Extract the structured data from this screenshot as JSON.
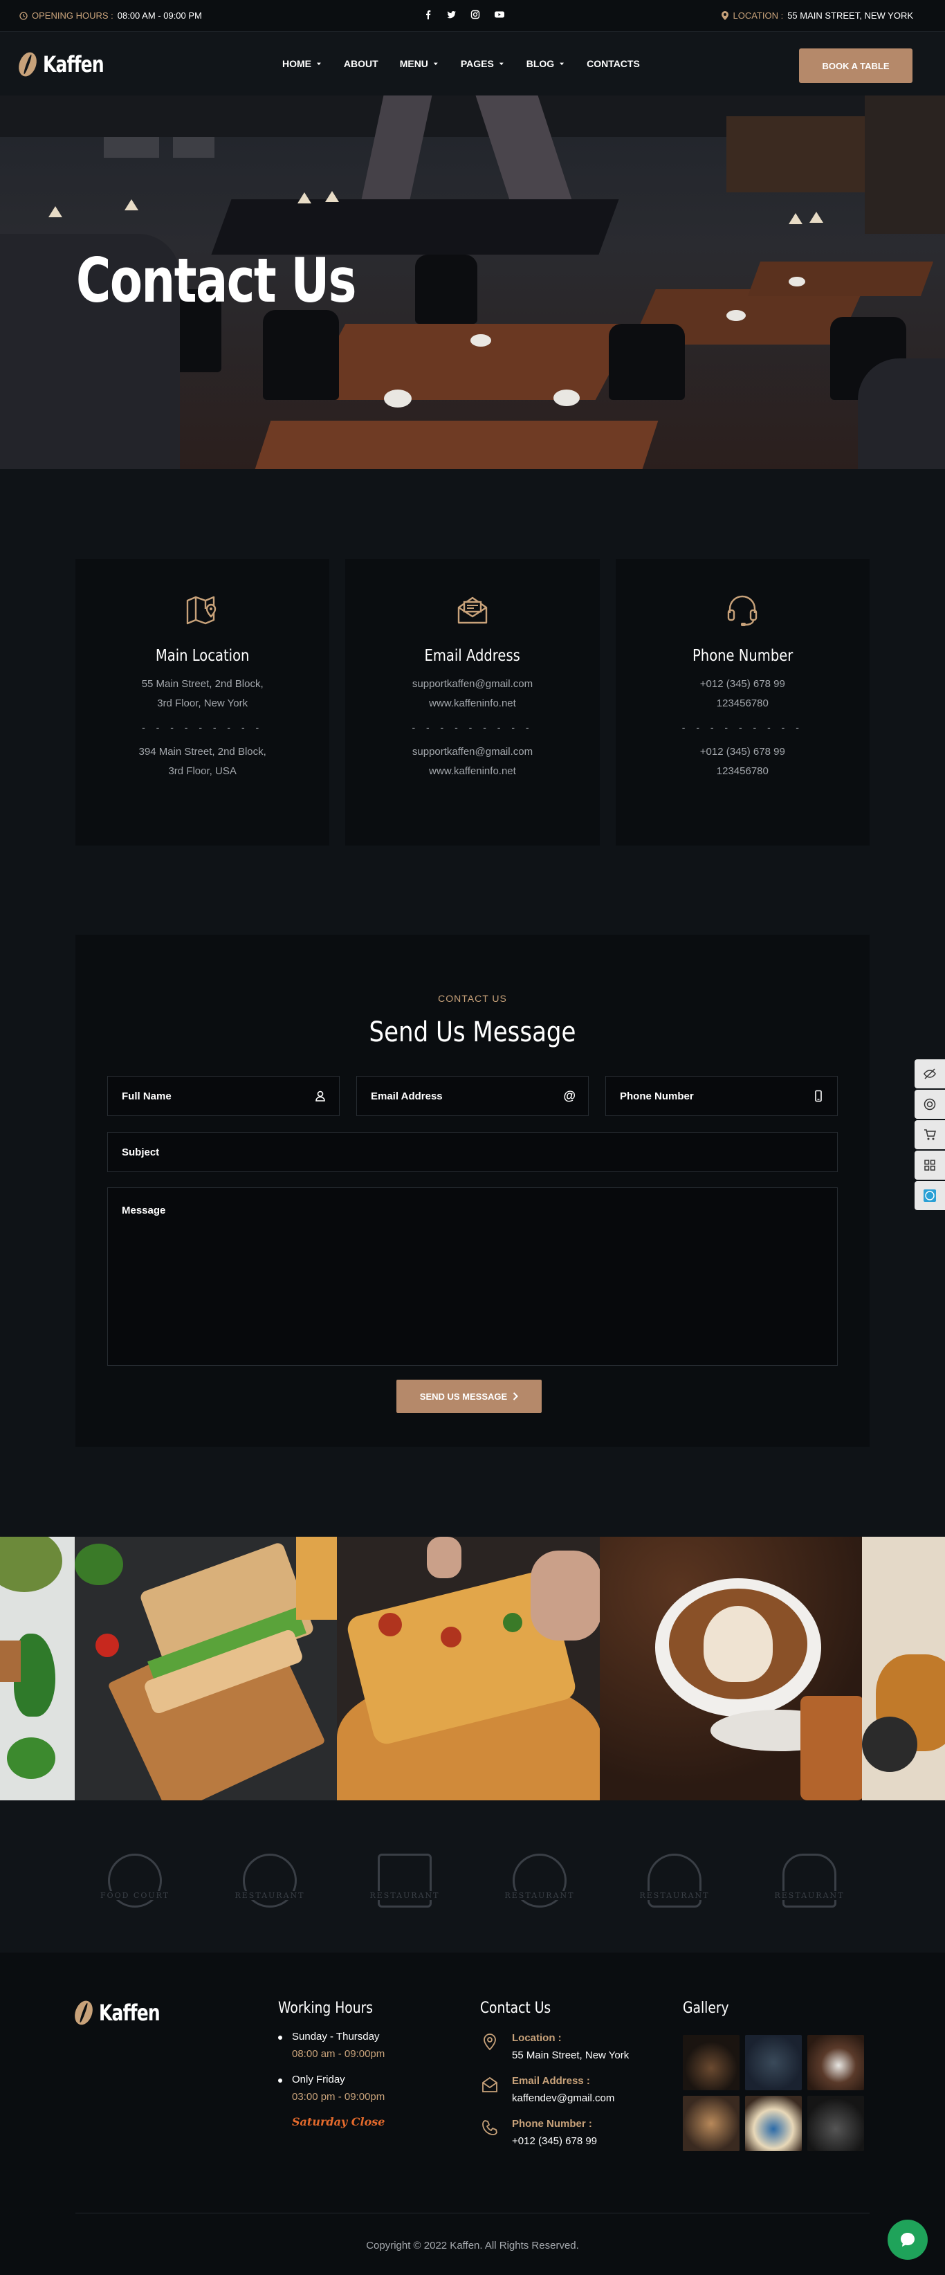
{
  "topbar": {
    "hours_label": "OPENING HOURS :",
    "hours_value": "08:00 AM - 09:00 PM",
    "location_label": "LOCATION :",
    "location_value": "55 MAIN STREET, NEW YORK",
    "social_icons": [
      "facebook-icon",
      "twitter-icon",
      "instagram-icon",
      "youtube-icon"
    ]
  },
  "header": {
    "logo": "Kaffen",
    "nav": [
      {
        "label": "HOME",
        "dropdown": true
      },
      {
        "label": "ABOUT",
        "dropdown": false
      },
      {
        "label": "MENU",
        "dropdown": true
      },
      {
        "label": "PAGES",
        "dropdown": true
      },
      {
        "label": "BLOG",
        "dropdown": true
      },
      {
        "label": "CONTACTS",
        "dropdown": false
      }
    ],
    "cta": "BOOK A TABLE"
  },
  "hero": {
    "title": "Contact Us"
  },
  "cards": [
    {
      "icon": "map-icon",
      "title": "Main Location",
      "line1a": "55 Main Street, 2nd Block,",
      "line1b": "3rd Floor, New York",
      "line2a": "394 Main Street, 2nd Block,",
      "line2b": "3rd Floor, USA"
    },
    {
      "icon": "envelope-open-icon",
      "title": "Email Address",
      "line1a": "supportkaffen@gmail.com",
      "line1b": "www.kaffeninfo.net",
      "line2a": "supportkaffen@gmail.com",
      "line2b": "www.kaffeninfo.net"
    },
    {
      "icon": "headset-icon",
      "title": "Phone Number",
      "line1a": "+012 (345) 678 99",
      "line1b": "123456780",
      "line2a": "+012 (345) 678 99",
      "line2b": "123456780"
    }
  ],
  "divider": "- - - - - - - - -",
  "form": {
    "eyebrow": "CONTACT US",
    "title": "Send Us Message",
    "full_name": "Full Name",
    "email": "Email Address",
    "phone": "Phone Number",
    "subject": "Subject",
    "message": "Message",
    "submit": "SEND US MESSAGE",
    "email_icon_glyph": "@"
  },
  "brands": [
    "FOOD COURT",
    "RESTAURANT",
    "RESTAURANT",
    "RESTAURANT",
    "RESTAURANT",
    "RESTAURANT"
  ],
  "footer": {
    "logo": "Kaffen",
    "working_hours": {
      "title": "Working Hours",
      "rows": [
        {
          "day": "Sunday - Thursday",
          "time": "08:00 am - 09:00pm"
        },
        {
          "day": "Only Friday",
          "time": "03:00 pm - 09:00pm"
        }
      ],
      "closed": "Saturday Close"
    },
    "contact": {
      "title": "Contact Us",
      "items": [
        {
          "icon": "location-pin-icon",
          "label": "Location :",
          "value": "55 Main Street, New York"
        },
        {
          "icon": "envelope-icon",
          "label": "Email Address :",
          "value": "kaffendev@gmail.com"
        },
        {
          "icon": "phone-icon",
          "label": "Phone Number :",
          "value": "+012 (345) 678 99"
        }
      ]
    },
    "gallery": {
      "title": "Gallery"
    },
    "copyright": "Copyright © 2022 Kaffen. All Rights Reserved."
  },
  "colors": {
    "accent": "#c8a27a",
    "button": "#b5896a",
    "bg": "#0f1317",
    "card": "#0a0d10",
    "closed": "#e46a2c",
    "chat": "#1fa35a"
  }
}
